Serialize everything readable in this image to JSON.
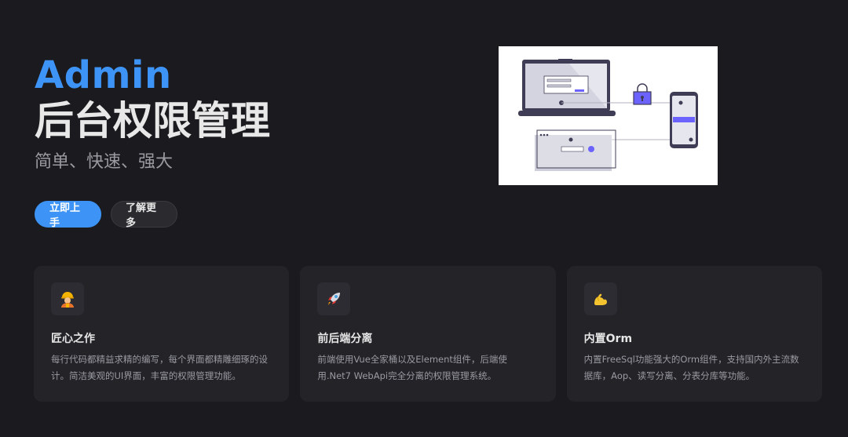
{
  "hero": {
    "brand": "Admin",
    "title": "后台权限管理",
    "tagline": "简单、快速、强大",
    "primary_button": "立即上手",
    "secondary_button": "了解更多"
  },
  "illustration": {
    "icon": "devices-lock-illustration",
    "accent_color": "#6c63ff"
  },
  "features": [
    {
      "icon": "construction-worker-icon",
      "title": "匠心之作",
      "desc": "每行代码都精益求精的编写，每个界面都精雕细琢的设计。简洁美观的UI界面，丰富的权限管理功能。"
    },
    {
      "icon": "rocket-icon",
      "title": "前后端分离",
      "desc": "前端使用Vue全家桶以及Element组件，后端使用.Net7 WebApi完全分离的权限管理系统。"
    },
    {
      "icon": "flexed-biceps-icon",
      "title": "内置Orm",
      "desc": "内置FreeSql功能强大的Orm组件，支持国内外主流数据库，Aop、读写分离、分表分库等功能。"
    }
  ],
  "colors": {
    "background": "#1b1b1f",
    "brand": "#3d94f6",
    "card": "#232328"
  }
}
